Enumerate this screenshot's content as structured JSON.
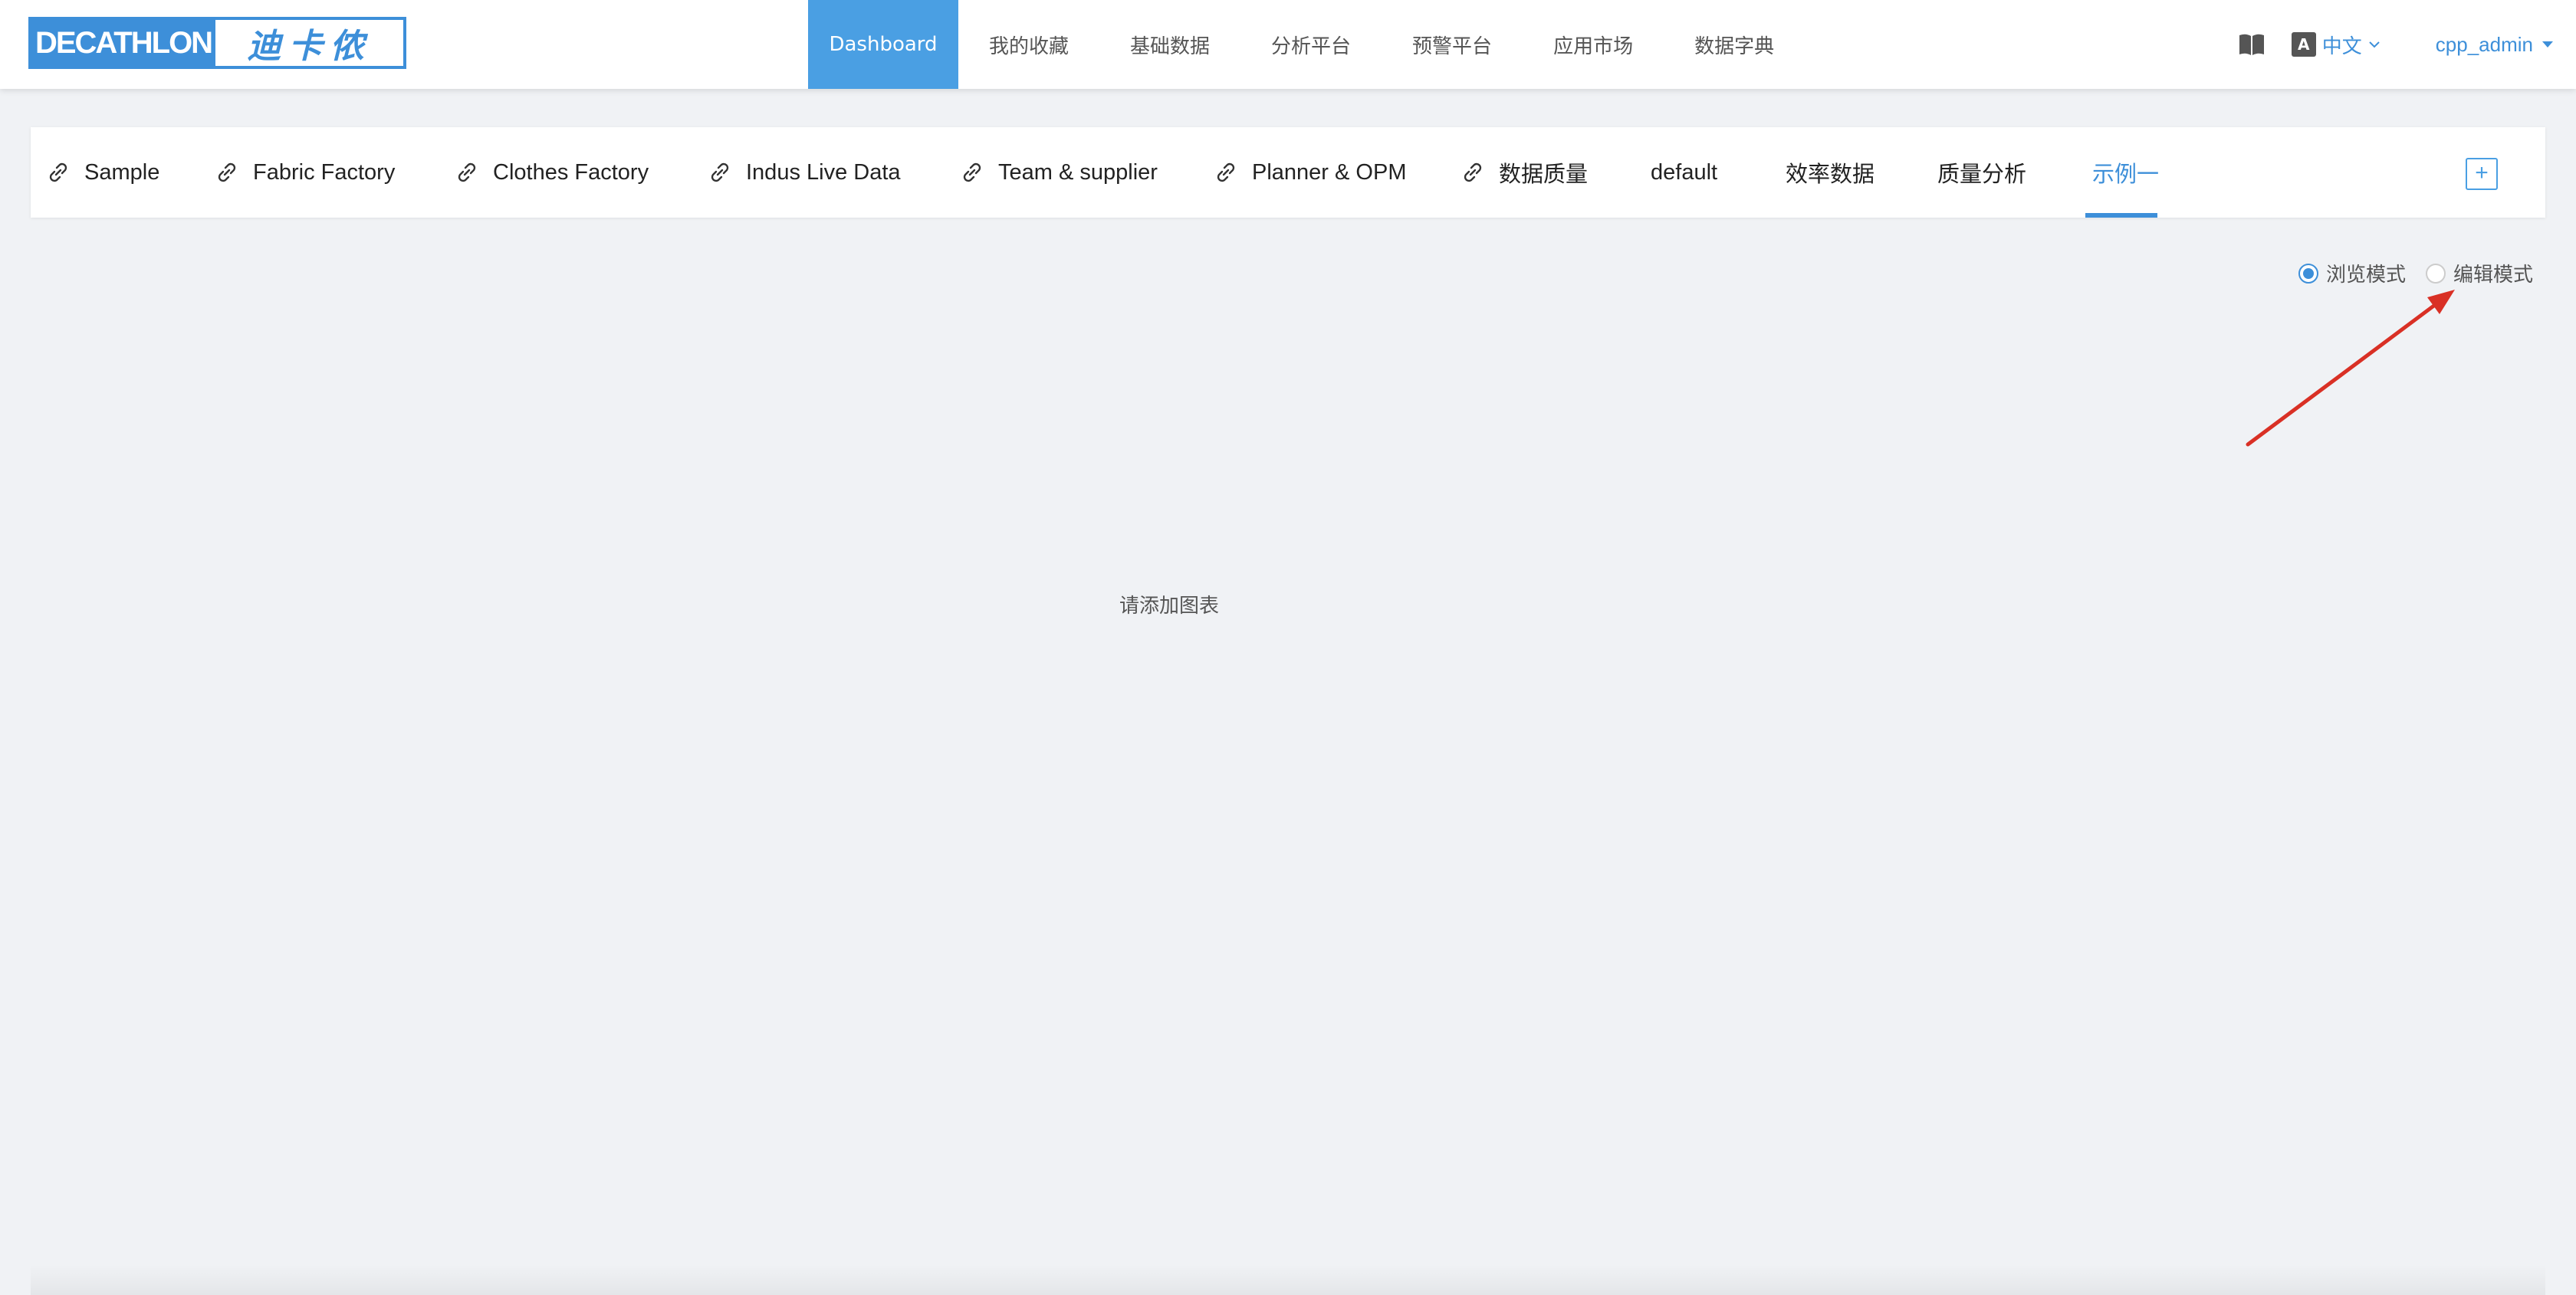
{
  "brand": {
    "logo_text_en": "DECATHLON",
    "logo_text_cn": "迪卡侬",
    "accent": "#3d8fd9"
  },
  "nav": {
    "items": [
      {
        "label": "Dashboard",
        "active": true
      },
      {
        "label": "我的收藏"
      },
      {
        "label": "基础数据"
      },
      {
        "label": "分析平台"
      },
      {
        "label": "预警平台"
      },
      {
        "label": "应用市场"
      },
      {
        "label": "数据字典"
      }
    ]
  },
  "header_right": {
    "book_icon": "book-icon",
    "language_icon_text": "A",
    "language": "中文",
    "user": "cpp_admin"
  },
  "tabs": [
    {
      "label": "Sample",
      "icon": "link-icon"
    },
    {
      "label": "Fabric Factory",
      "icon": "link-icon"
    },
    {
      "label": "Clothes Factory",
      "icon": "link-icon"
    },
    {
      "label": "Indus Live Data",
      "icon": "link-icon"
    },
    {
      "label": "Team & supplier",
      "icon": "link-icon"
    },
    {
      "label": "Planner & OPM",
      "icon": "link-icon"
    },
    {
      "label": "数据质量",
      "icon": "link-icon"
    },
    {
      "label": "default"
    },
    {
      "label": "效率数据"
    },
    {
      "label": "质量分析"
    },
    {
      "label": "示例一",
      "active": true
    }
  ],
  "add_tab_label": "+",
  "modes": {
    "browse": "浏览模式",
    "edit": "编辑模式",
    "selected": "browse"
  },
  "empty_message": "请添加图表"
}
